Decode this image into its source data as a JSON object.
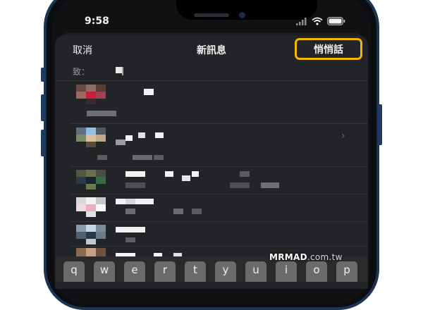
{
  "status_bar": {
    "time": "9:58"
  },
  "nav": {
    "cancel_label": "取消",
    "title": "新訊息",
    "whisper_label": "悄悄話"
  },
  "to_field": {
    "label": "致："
  },
  "chevron": "›",
  "keyboard": {
    "keys": [
      "q",
      "w",
      "e",
      "r",
      "t",
      "y",
      "u",
      "i",
      "o",
      "p"
    ]
  },
  "watermark": {
    "brand": "MRMAD",
    "domain": ".com.tw"
  },
  "colors": {
    "highlight": "#f4b400",
    "sheet": "#232428",
    "phone_frame": "#1c3352"
  },
  "contacts_blurred": true
}
